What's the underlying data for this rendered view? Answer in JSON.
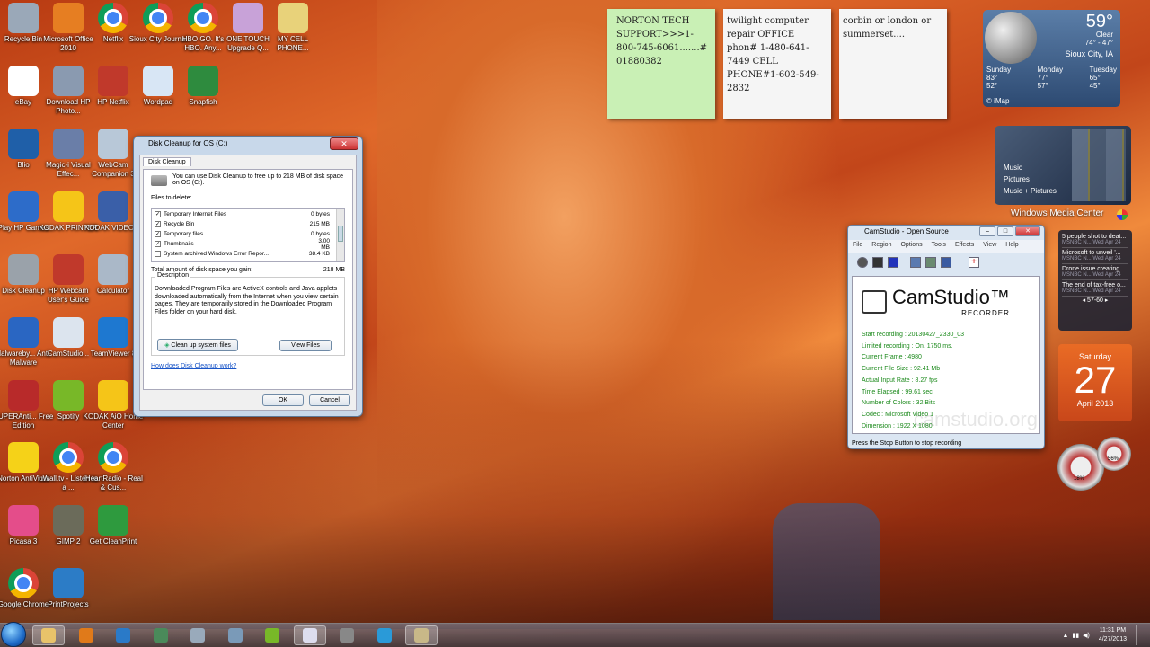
{
  "desktop_icons": [
    {
      "label": "Recycle Bin",
      "icon": "recycle-bin-icon"
    },
    {
      "label": "Microsoft Office 2010",
      "icon": "office-icon"
    },
    {
      "label": "Netflix",
      "icon": "chrome-icon"
    },
    {
      "label": "Sioux City Journal",
      "icon": "chrome-icon"
    },
    {
      "label": "HBO GO. It's HBO. Any...",
      "icon": "chrome-icon"
    },
    {
      "label": "ONE TOUCH Upgrade Q...",
      "icon": "onetouch-icon"
    },
    {
      "label": "MY CELL PHONE...",
      "icon": "folder-icon"
    },
    {
      "label": "eBay",
      "icon": "ebay-icon"
    },
    {
      "label": "Download HP Photo...",
      "icon": "camera-icon"
    },
    {
      "label": "HP Netflix",
      "icon": "netflix-icon"
    },
    {
      "label": "Wordpad",
      "icon": "wordpad-icon"
    },
    {
      "label": "Snapfish",
      "icon": "snapfish-icon"
    },
    {
      "label": "Blio",
      "icon": "blio-icon"
    },
    {
      "label": "Magic-i Visual Effec...",
      "icon": "magic-i-icon"
    },
    {
      "label": "WebCam Companion 3",
      "icon": "webcam-icon"
    },
    {
      "label": "Play HP Games",
      "icon": "games-icon"
    },
    {
      "label": "KODAK PRINTER",
      "icon": "kodak-icon"
    },
    {
      "label": "KODAK VIDEO ...",
      "icon": "kodak-video-icon"
    },
    {
      "label": "Disk Cleanup",
      "icon": "disk-cleanup-icon"
    },
    {
      "label": "HP Webcam User's Guide",
      "icon": "pdf-icon"
    },
    {
      "label": "Calculator",
      "icon": "calculator-icon"
    },
    {
      "label": "Malwareby... Anti-Malware",
      "icon": "malwarebytes-icon"
    },
    {
      "label": "CamStudio...",
      "icon": "camstudio-icon"
    },
    {
      "label": "TeamViewer 8",
      "icon": "teamviewer-icon"
    },
    {
      "label": "SUPERAnti... Free Edition",
      "icon": "superantispyware-icon"
    },
    {
      "label": "Spotify",
      "icon": "spotify-icon"
    },
    {
      "label": "KODAK AiO Home Center",
      "icon": "kodak-aio-icon"
    },
    {
      "label": "Norton AntiVirus",
      "icon": "norton-icon"
    },
    {
      "label": "uWall.tv - Listen to a ...",
      "icon": "chrome-icon"
    },
    {
      "label": "iHeartRadio - Real & Cus...",
      "icon": "chrome-icon"
    },
    {
      "label": "Picasa 3",
      "icon": "picasa-icon"
    },
    {
      "label": "GIMP 2",
      "icon": "gimp-icon"
    },
    {
      "label": "Get CleanPrint",
      "icon": "cleanprint-icon"
    },
    {
      "label": "Google Chrome",
      "icon": "chrome-icon"
    },
    {
      "label": "PrintProjects",
      "icon": "printprojects-icon"
    }
  ],
  "sticky_notes": [
    {
      "text": "NORTON TECH SUPPORT>>>1-800-745-6061.......# 01880382",
      "color": "#c9f0b5"
    },
    {
      "text": "twilight computer repair OFFICE phon# 1-480-641-7449 CELL PHONE#1-602-549-2832",
      "color": "#f5f5f5"
    },
    {
      "text": "corbin or london or summerset....",
      "color": "#f5f5f5"
    }
  ],
  "weather": {
    "temp": "59°",
    "condition": "Clear",
    "range": "74° - 47°",
    "city": "Sioux City, IA",
    "forecast": [
      {
        "day": "Sunday",
        "hi": "83°",
        "lo": "52°"
      },
      {
        "day": "Monday",
        "hi": "77°",
        "lo": "57°"
      },
      {
        "day": "Tuesday",
        "hi": "65°",
        "lo": "45°"
      }
    ],
    "source": "© iMap"
  },
  "media_center": {
    "items": [
      "Music",
      "Pictures",
      "Music + Pictures"
    ],
    "caption": "Windows Media Center"
  },
  "news": {
    "items": [
      {
        "title": "5 people shot to deat...",
        "source": "MSNBC N... Wed Apr 24"
      },
      {
        "title": "Microsoft to unveil '...",
        "source": "MSNBC N... Wed Apr 24"
      },
      {
        "title": "Drone issue creating ...",
        "source": "MSNBC N... Wed Apr 24"
      },
      {
        "title": "The end of tax-free o...",
        "source": "MSNBC N... Wed Apr 24"
      }
    ],
    "pager": "57-60"
  },
  "calendar": {
    "weekday": "Saturday",
    "day": "27",
    "month_year": "April 2013"
  },
  "cpu_meter": {
    "cpu": "18%",
    "mem": "56%"
  },
  "disk_cleanup": {
    "title": "Disk Cleanup for OS (C:)",
    "close_label": "✕",
    "tab": "Disk Cleanup",
    "intro": "You can use Disk Cleanup to free up to 218 MB of disk space on OS (C:).",
    "files_label": "Files to delete:",
    "files": [
      {
        "name": "Temporary Internet Files",
        "size": "0 bytes",
        "checked": "✓"
      },
      {
        "name": "Recycle Bin",
        "size": "215 MB",
        "checked": "✓"
      },
      {
        "name": "Temporary files",
        "size": "0 bytes",
        "checked": "✓"
      },
      {
        "name": "Thumbnails",
        "size": "3.00 MB",
        "checked": "✓"
      },
      {
        "name": "System archived Windows Error Repor...",
        "size": "38.4 KB",
        "checked": ""
      }
    ],
    "total_label": "Total amount of disk space you gain:",
    "total_value": "218 MB",
    "description_label": "Description",
    "description": "Downloaded Program Files are ActiveX controls and Java applets downloaded automatically from the Internet when you view certain pages. They are temporarily stored in the Downloaded Program Files folder on your hard disk.",
    "cleanup_system_label": "Clean up system files",
    "view_files_label": "View Files",
    "help_link": "How does Disk Cleanup work?",
    "ok_label": "OK",
    "cancel_label": "Cancel"
  },
  "camstudio": {
    "title": "CamStudio - Open Source",
    "menu": [
      "File",
      "Region",
      "Options",
      "Tools",
      "Effects",
      "View",
      "Help"
    ],
    "logo_name": "CamStudio™",
    "logo_sub": "RECORDER",
    "stats": [
      "Start recording : 20130427_2330_03",
      "Limited recording : On. 1750 ms.",
      "Current Frame : 4980",
      "Current File Size : 92.41 Mb",
      "Actual Input Rate : 8.27 fps",
      "Time Elapsed : 99.61 sec",
      "Number of Colors : 32 Bits",
      "Codec : Microsoft Video 1",
      "Dimension : 1922 X 1080"
    ],
    "watermark": "camstudio.org",
    "status": "Press the Stop Button to stop recording"
  },
  "taskbar": {
    "apps": [
      "windows-explorer",
      "media-player",
      "internet-explorer",
      "snipping",
      "calculator",
      "computer",
      "spotify",
      "camstudio",
      "cleanup",
      "skype",
      "disk-cleanup"
    ],
    "time": "11:31 PM",
    "date": "4/27/2013"
  }
}
